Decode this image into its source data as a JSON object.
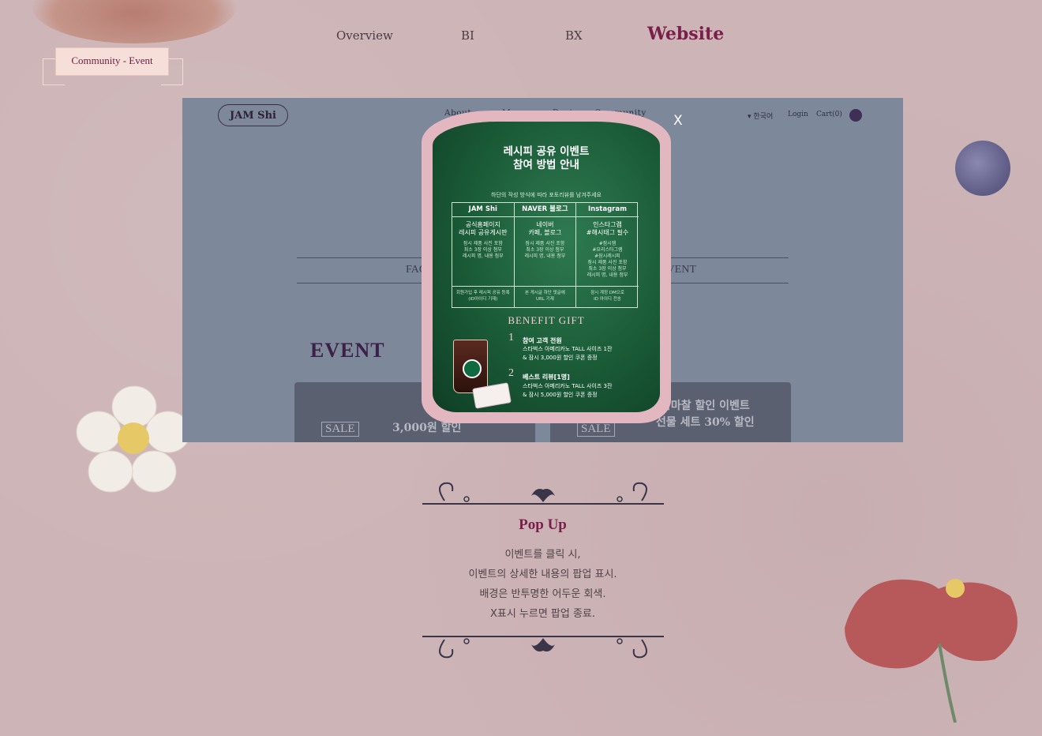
{
  "nav": {
    "overview": "Overview",
    "bi": "BI",
    "bx": "BX",
    "website": "Website"
  },
  "section_label": "Community - Event",
  "site": {
    "logo": "JAM Shi",
    "menu": [
      "About",
      "Menu",
      "Recipe",
      "Community"
    ],
    "lang": "한국어",
    "login": "Login",
    "cart": "Cart(0)",
    "tab_left": "FAQ",
    "tab_right": "EVENT",
    "event_heading": "EVENT",
    "card1_sale": "SALE",
    "card1_text": "3,000원 할인",
    "card2_sale": "SALE",
    "card2_text1": "잠마찰 할인 이벤트",
    "card2_text2": "선물 세트 30% 할인",
    "close": "X"
  },
  "popup": {
    "title1": "레시피 공유 이벤트",
    "title2": "참여 방법 안내",
    "subtitle": "하단의 작성 방식에 따라 포토리뷰를 남겨주세요",
    "columns": [
      {
        "head": "JAM Shi",
        "title": "공식홈페이지\n레시피 공유게시판",
        "body": "잠시 제품 사진 포함\n최소 3장 이상 첨부\n레시피 명, 내용 첨부",
        "foot": "회원가입 후 레시피 공유 등록\n(ID아이디 기재)"
      },
      {
        "head": "NAVER 블로그",
        "title": "네이버\n카페, 블로그",
        "body": "잠시 제품 사진 포함\n최소 3장 이상 첨부\n레시피 명, 내용 첨부",
        "foot": "본 게시글 하단 댓글에\nURL 기재"
      },
      {
        "head": "Instagram",
        "title": "인스타그램\n#해시태그 필수",
        "body": "#잠시잼\n#요리스타그램\n#잠시레시피\n잠시 제품 사진 포함\n최소 3장 이상 첨부\n레시피 명, 내용 첨부",
        "foot": "잠시 계정 DM으로\nID 아이디 전송"
      }
    ],
    "benefit": "BENEFIT GIFT",
    "gift1_num": "1",
    "gift1_title": "참여 고객 전원",
    "gift1_text": "스타벅스 아메리카노 TALL 사이즈 1잔\n& 잠시 3,000원 할인 쿠폰 증정",
    "gift2_num": "2",
    "gift2_title": "베스트 리뷰[1명]",
    "gift2_text": "스타벅스 아메리카노 TALL 사이즈 3잔\n& 잠시 5,000원 할인 쿠폰 증정"
  },
  "bottom": {
    "title": "Pop Up",
    "lines": [
      "이벤트를 클릭 시,",
      "이벤트의 상세한 내용의 팝업 표시.",
      "배경은 반투명한 어두운 회색.",
      "X표시 누르면 팝업 종료."
    ]
  },
  "colors": {
    "background": "#cdb4b6",
    "accent": "#7a1f4a",
    "popup_green": "#1a5a37",
    "popup_frame": "#e3b7bf",
    "overlay": "#7e889b"
  }
}
